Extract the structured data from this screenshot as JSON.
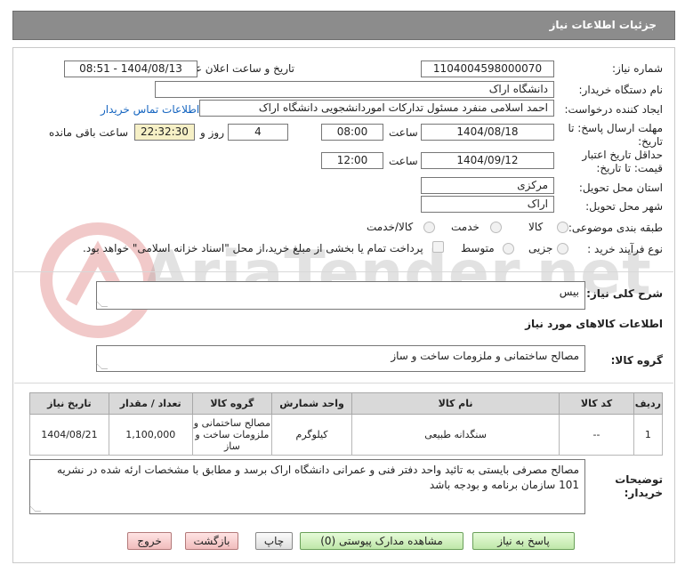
{
  "header": {
    "title": "جزئیات اطلاعات نیاز"
  },
  "form": {
    "need_number_label": "شماره نیاز:",
    "need_number": "1104004598000070",
    "announce_label": "تاریخ و ساعت اعلان عمومی:",
    "announce_value": "1404/08/13 - 08:51",
    "buyer_org_label": "نام دستگاه خریدار:",
    "buyer_org": "دانشگاه اراک",
    "creator_label": "ایجاد کننده درخواست:",
    "creator": "احمد  اسلامی منفرد مسئول تدارکات اموردانشجویی دانشگاه اراک",
    "contact_link": "اطلاعات تماس خریدار",
    "deadline_label_1": "مهلت ارسال پاسخ: تا",
    "deadline_label_2": "تاریخ:",
    "deadline_date": "1404/08/18",
    "time_label": "ساعت",
    "deadline_time": "08:00",
    "days_value": "4",
    "days_label": "روز و",
    "remaining_time": "22:32:30",
    "remaining_label": "ساعت باقی مانده",
    "validity_label_1": "حداقل تاریخ اعتبار",
    "validity_label_2": "قیمت: تا تاریخ:",
    "validity_date": "1404/09/12",
    "validity_time_label": "ساعت",
    "validity_time": "12:00",
    "province_label": "استان محل تحویل:",
    "province": "مرکزی",
    "city_label": "شهر محل تحویل:",
    "city": "اراک",
    "category_label": "طبقه بندی موضوعی:",
    "category_options": [
      "کالا",
      "خدمت",
      "کالا/خدمت"
    ],
    "process_label": "نوع فرآیند خرید :",
    "process_options": [
      "جزیی",
      "متوسط"
    ],
    "payment_note": "پرداخت تمام یا بخشی از مبلغ خرید،از محل \"اسناد خزانه اسلامی\" خواهد بود."
  },
  "summary": {
    "label": "شرح کلی نیاز:",
    "value": "بیس"
  },
  "goods_info": {
    "title": "اطلاعات کالاهای مورد نیاز",
    "group_label": "گروه کالا:",
    "group_value": "مصالح ساختمانی و ملزومات ساخت و ساز"
  },
  "table": {
    "headers": [
      "ردیف",
      "کد کالا",
      "نام کالا",
      "واحد شمارش",
      "گروه کالا",
      "تعداد / مقدار",
      "تاریخ نیاز"
    ],
    "rows": [
      {
        "index": "1",
        "code": "--",
        "name": "سنگدانه طبیعی",
        "unit": "کیلوگرم",
        "group": "مصالح ساختمانی و ملزومات ساخت و ساز",
        "qty": "1,100,000",
        "date": "1404/08/21"
      }
    ]
  },
  "buyer_notes": {
    "label_1": "توضیحات",
    "label_2": "خریدار:",
    "value": "مصالح مصرفی بایستی به تائید واحد دفتر فنی و عمرانی دانشگاه اراک برسد و مطابق با مشخصات ارئه شده در نشریه 101 سازمان برنامه و بودجه باشد"
  },
  "buttons": {
    "reply": "پاسخ به نیاز",
    "docs": "مشاهده مدارک پیوستی (0)",
    "print": "چاپ",
    "back": "بازگشت",
    "exit": "خروج"
  },
  "colors": {
    "header_bg": "#8c8c8c",
    "link": "#1565c0",
    "remaining_bg": "#f6f0c6"
  }
}
